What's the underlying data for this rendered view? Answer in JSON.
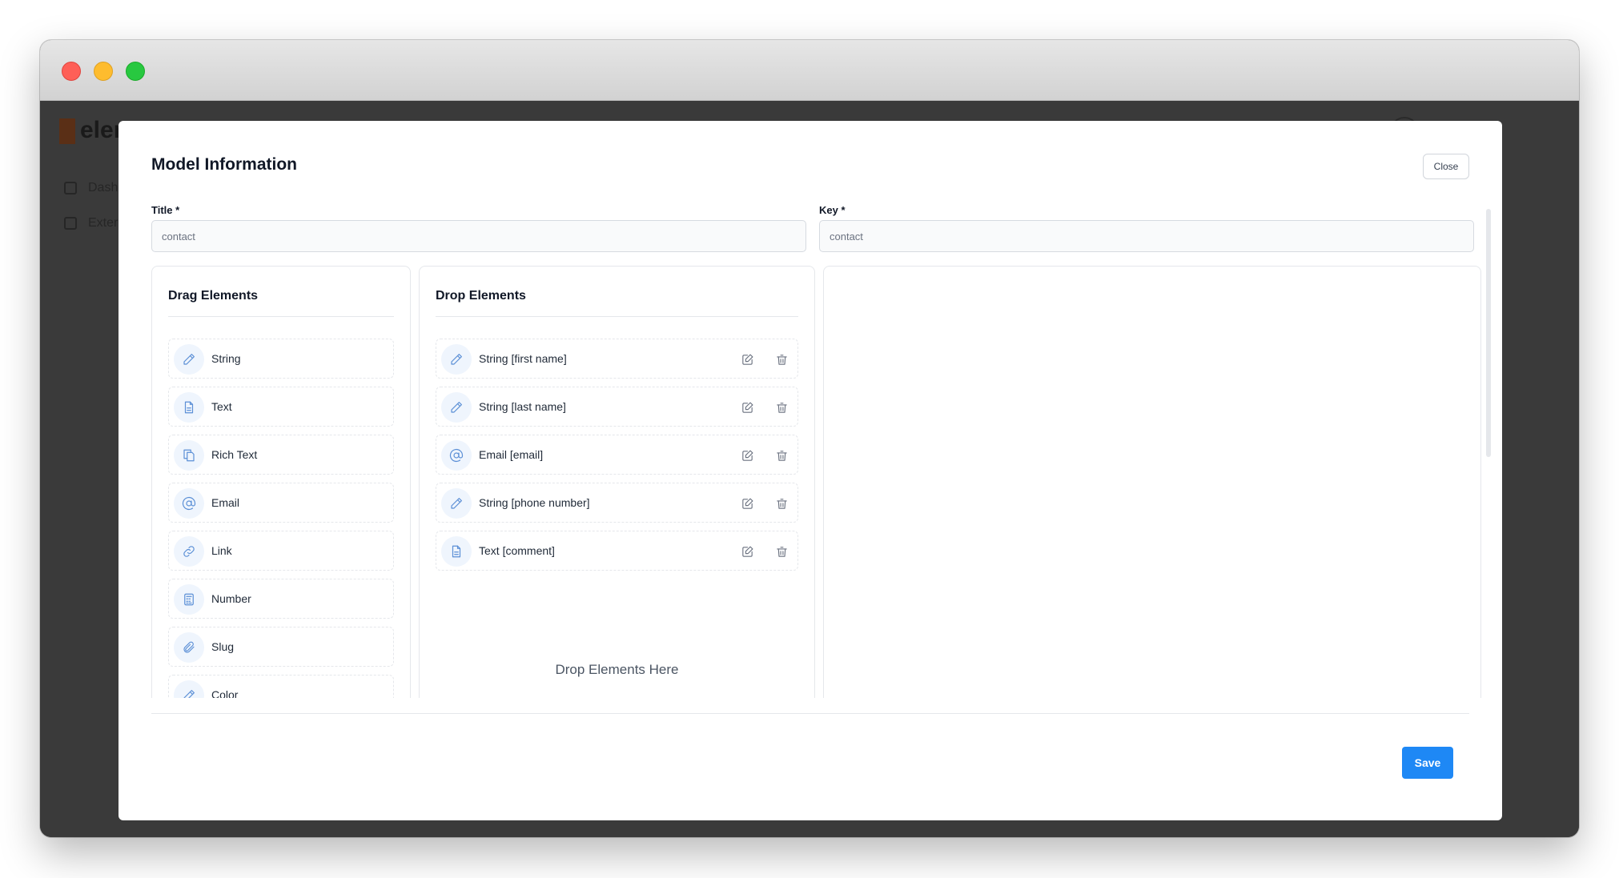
{
  "app": {
    "logo_text": "eler",
    "nav": [
      "Dash",
      "Exter"
    ]
  },
  "modal": {
    "title": "Model Information",
    "close_label": "Close",
    "save_label": "Save"
  },
  "form": {
    "title_label": "Title *",
    "title_value": "contact",
    "key_label": "Key *",
    "key_value": "contact"
  },
  "drag_panel": {
    "title": "Drag Elements",
    "items": [
      {
        "label": "String",
        "icon": "pencil-icon"
      },
      {
        "label": "Text",
        "icon": "document-icon"
      },
      {
        "label": "Rich Text",
        "icon": "copy-document-icon"
      },
      {
        "label": "Email",
        "icon": "at-sign-icon"
      },
      {
        "label": "Link",
        "icon": "link-icon"
      },
      {
        "label": "Number",
        "icon": "calculator-icon"
      },
      {
        "label": "Slug",
        "icon": "paperclip-icon"
      },
      {
        "label": "Color",
        "icon": "pencil-icon"
      }
    ]
  },
  "drop_panel": {
    "title": "Drop Elements",
    "items": [
      {
        "label": "String [first name]",
        "icon": "pencil-icon"
      },
      {
        "label": "String [last name]",
        "icon": "pencil-icon"
      },
      {
        "label": "Email [email]",
        "icon": "at-sign-icon"
      },
      {
        "label": "String [phone number]",
        "icon": "pencil-icon"
      },
      {
        "label": "Text [comment]",
        "icon": "document-icon"
      }
    ],
    "drop_hint": "Drop Elements Here"
  },
  "colors": {
    "primary": "#1e88f5",
    "icon_bg": "#eff5fd",
    "icon_stroke": "#5b8fd6"
  }
}
